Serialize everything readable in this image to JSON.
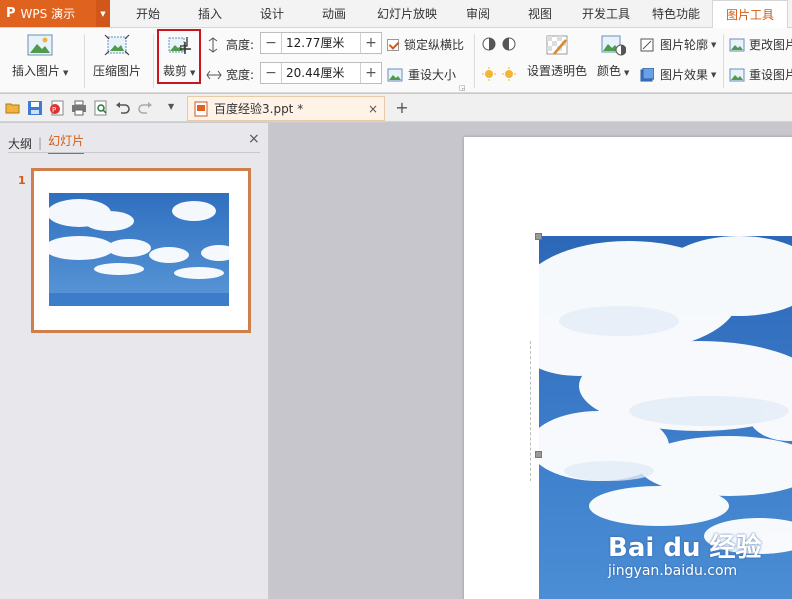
{
  "app": {
    "logo": "P",
    "name": "WPS 演示"
  },
  "menu_tabs": [
    "开始",
    "插入",
    "设计",
    "动画",
    "幻灯片放映",
    "审阅",
    "视图",
    "开发工具",
    "特色功能",
    "图片工具"
  ],
  "active_tab": "图片工具",
  "ribbon": {
    "insert_picture": "插入图片",
    "compress_picture": "压缩图片",
    "crop": "裁剪",
    "height_label": "高度:",
    "height_value": "12.77厘米",
    "width_label": "宽度:",
    "width_value": "20.44厘米",
    "lock_ratio": "锁定纵横比",
    "reset_size": "重设大小",
    "set_transparent": "设置透明色",
    "color": "颜色",
    "picture_outline": "图片轮廓",
    "picture_effect": "图片效果",
    "change_picture": "更改图片",
    "reset_picture": "重设图片",
    "minus": "−",
    "plus": "+"
  },
  "doc_tab": {
    "name": "百度经验3.ppt *",
    "close": "×",
    "add": "+"
  },
  "left_pane": {
    "tab_outline": "大纲",
    "tab_slides": "幻灯片",
    "divider": "|",
    "close": "×",
    "slide_number": "1"
  },
  "watermark": {
    "logo": "Bai du 经验",
    "url": "jingyan.baidu.com"
  },
  "colors": {
    "accent": "#d35a12",
    "app_orange": "#e0621f",
    "highlight_red": "#c8161e",
    "sky": "#3a78c2"
  }
}
